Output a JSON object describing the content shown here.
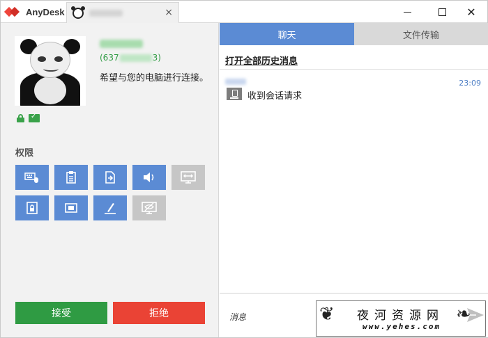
{
  "app": {
    "name": "AnyDesk"
  },
  "session_tab": {
    "close_glyph": "×"
  },
  "window_controls": {
    "close_glyph": "✕"
  },
  "remote": {
    "id_prefix": "(637",
    "id_suffix": "3)",
    "request_text": "希望与您的电脑进行连接。"
  },
  "permissions": {
    "title": "权限",
    "items": [
      {
        "name": "keyboard-mouse",
        "enabled": true
      },
      {
        "name": "clipboard",
        "enabled": true
      },
      {
        "name": "file-transfer",
        "enabled": true
      },
      {
        "name": "sound",
        "enabled": true
      },
      {
        "name": "control-switch",
        "enabled": false
      },
      {
        "name": "lock-account",
        "enabled": true
      },
      {
        "name": "record-session",
        "enabled": true
      },
      {
        "name": "draw",
        "enabled": true
      },
      {
        "name": "privacy-mode",
        "enabled": false
      }
    ]
  },
  "actions": {
    "accept": "接受",
    "reject": "拒绝"
  },
  "chat": {
    "tabs": {
      "chat": "聊天",
      "files": "文件传输"
    },
    "history_link": "打开全部历史消息",
    "messages": [
      {
        "time": "23:09",
        "text": "收到会话请求"
      }
    ],
    "input_placeholder": "消息"
  },
  "watermark": {
    "title": "夜河资源网",
    "url": "www.yehes.com"
  },
  "colors": {
    "accent": "#5b8bd4",
    "accept": "#2f9b43",
    "reject": "#ea4335",
    "brand": "#ef443b",
    "disabled": "#c6c6c6"
  }
}
